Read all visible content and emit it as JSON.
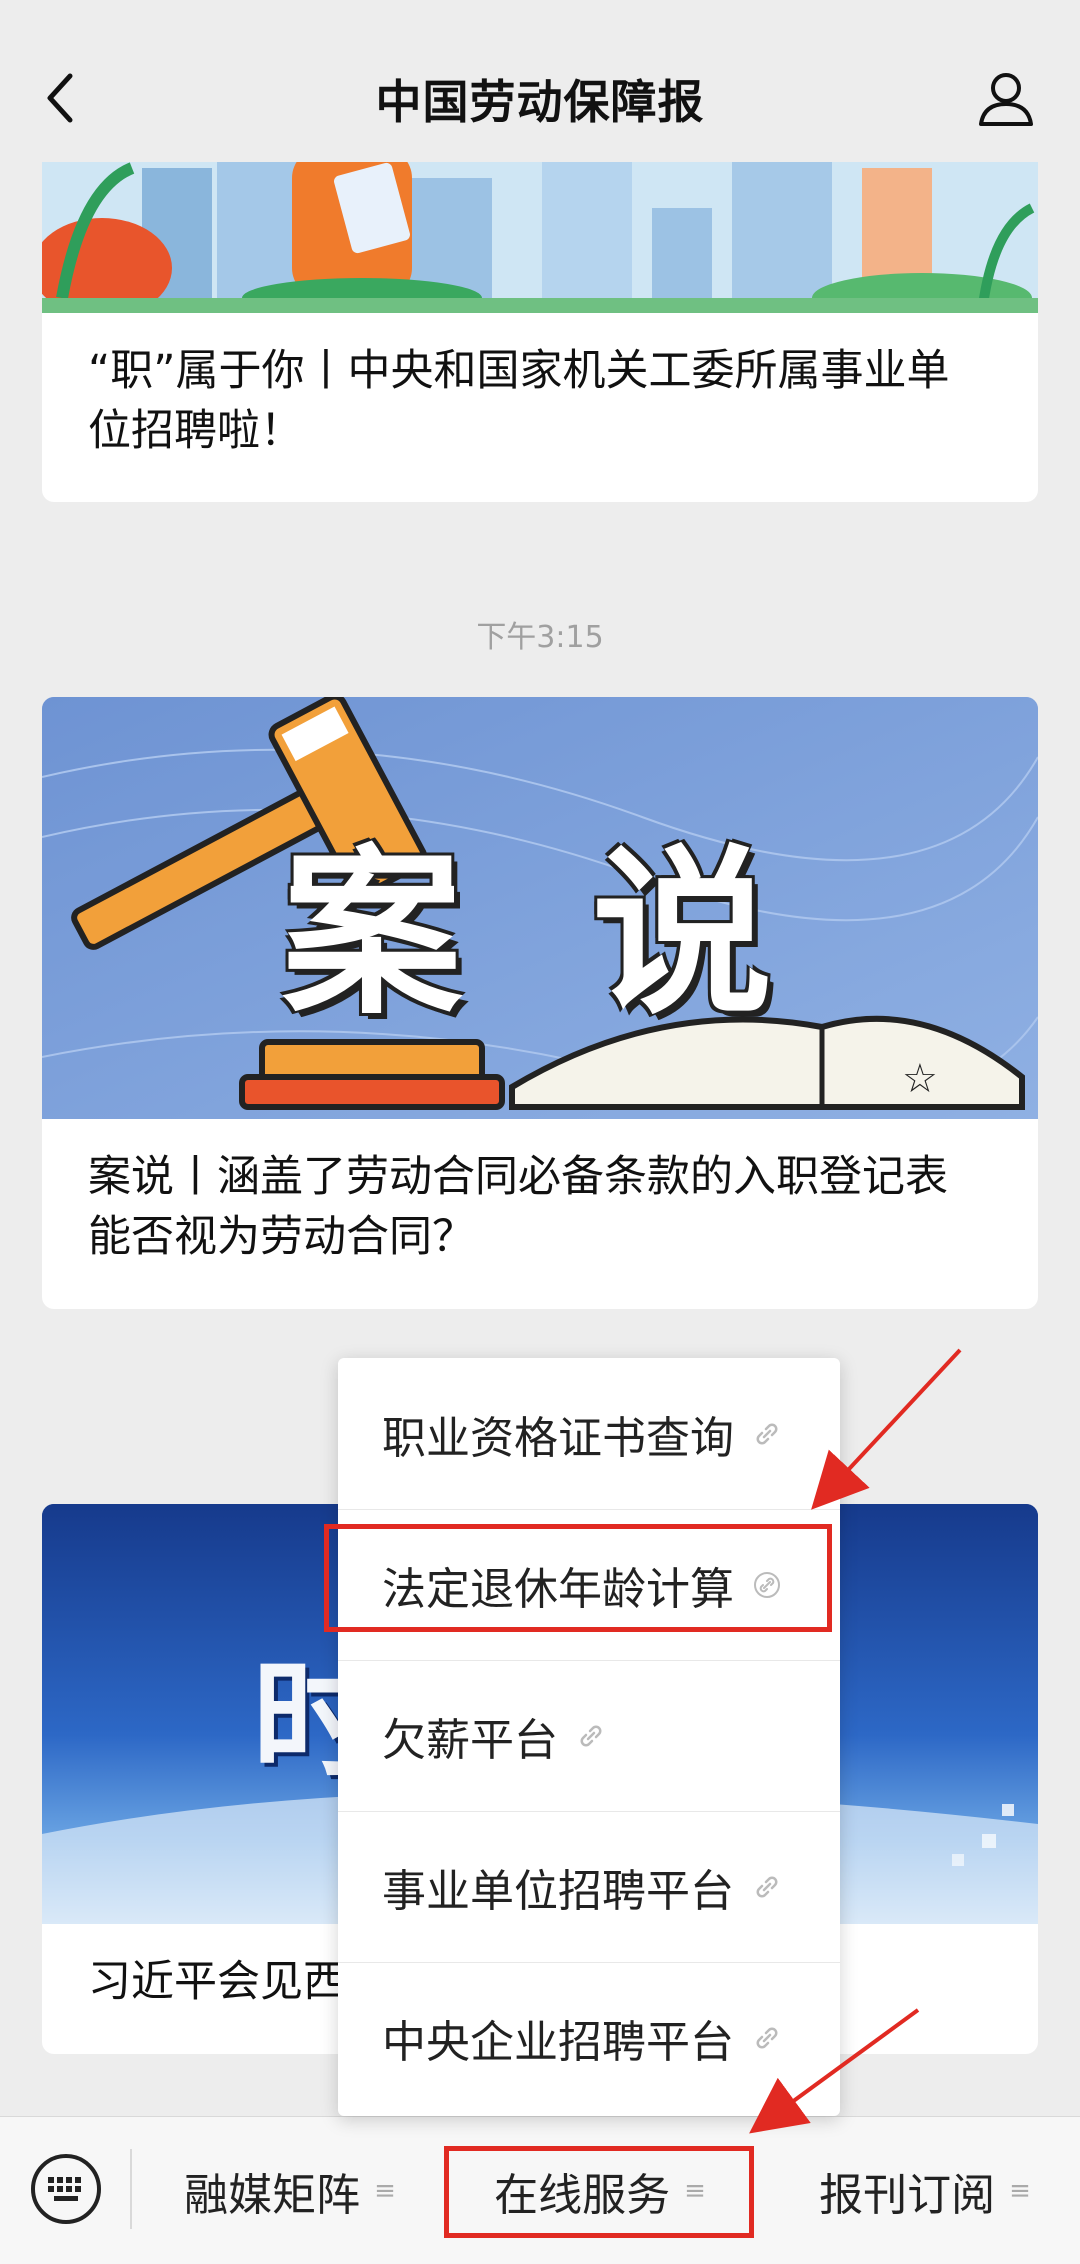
{
  "header": {
    "title": "中国劳动保障报"
  },
  "feed": {
    "article1_title": "“职”属于你丨中央和国家机关工委所属事业单位招聘啦！",
    "timestamp": "下午3:15",
    "article2_image_text": "案说",
    "article2_title": "案说丨涵盖了劳动合同必备条款的入职登记表 能否视为劳动合同？",
    "article3_image_text": "时",
    "article3_title": "习近平会见西"
  },
  "popup": {
    "items": [
      {
        "label": "职业资格证书查询"
      },
      {
        "label": "法定退休年龄计算"
      },
      {
        "label": "欠薪平台"
      },
      {
        "label": "事业单位招聘平台"
      },
      {
        "label": "中央企业招聘平台"
      }
    ]
  },
  "bottom_menu": {
    "items": [
      {
        "label": "融媒矩阵"
      },
      {
        "label": "在线服务"
      },
      {
        "label": "报刊订阅"
      }
    ],
    "menu_icon": "≡"
  },
  "icons": {
    "back": "chevron-left-icon",
    "profile": "person-icon",
    "keyboard": "keyboard-icon",
    "link": "link-icon"
  },
  "accent_colors": {
    "highlight": "#e12a22",
    "header_bg": "#ededed"
  }
}
